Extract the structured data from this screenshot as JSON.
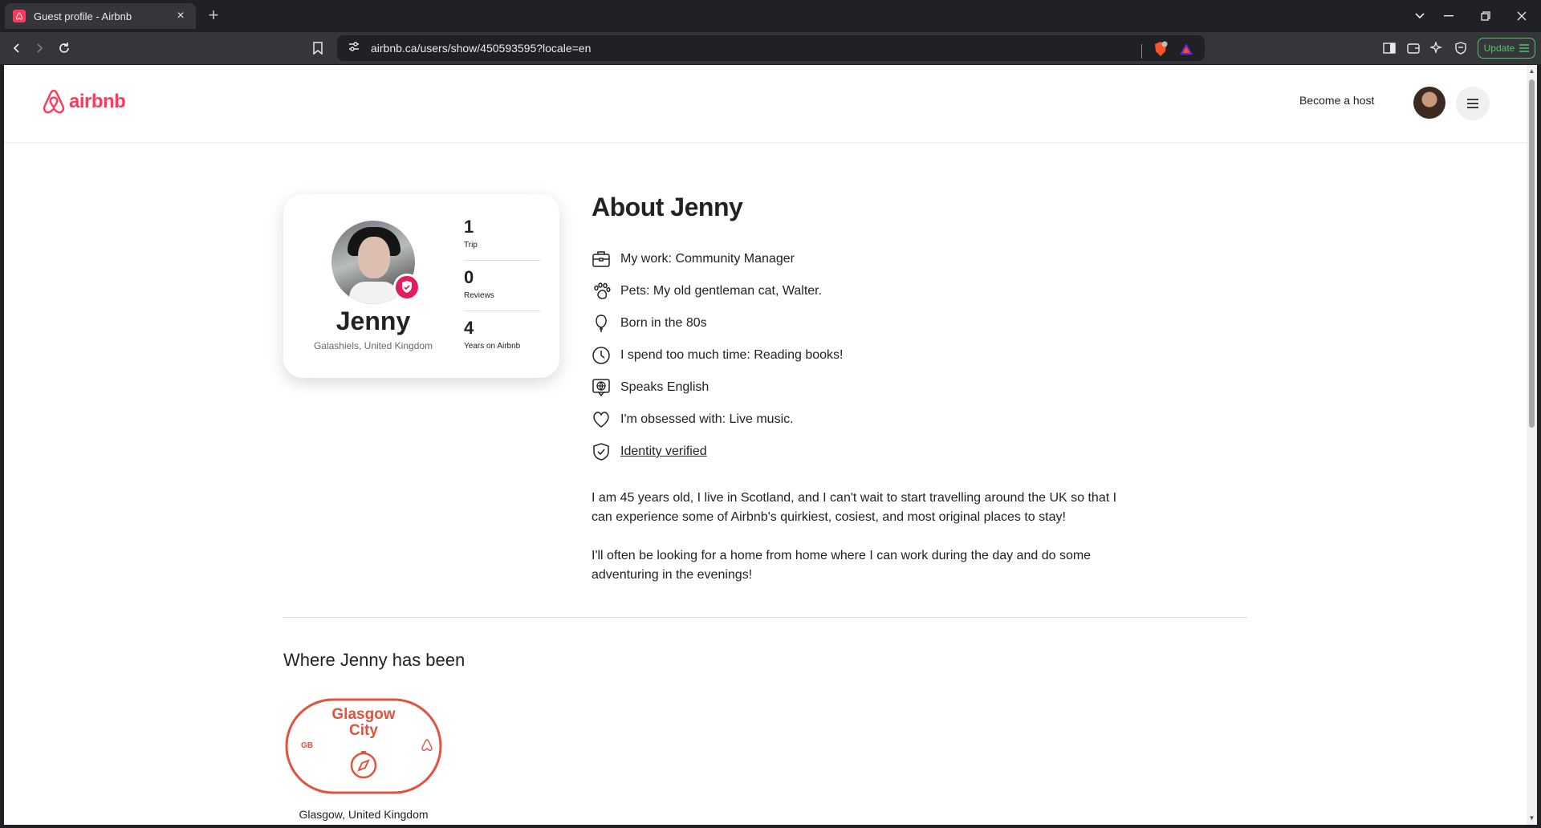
{
  "browser": {
    "tab_title": "Guest profile - Airbnb",
    "url": "airbnb.ca/users/show/450593595?locale=en",
    "update_label": "Update"
  },
  "header": {
    "brand": "airbnb",
    "become_host": "Become a host"
  },
  "profile": {
    "name": "Jenny",
    "location": "Galashiels, United Kingdom",
    "stats": [
      {
        "value": "1",
        "label": "Trip"
      },
      {
        "value": "0",
        "label": "Reviews"
      },
      {
        "value": "4",
        "label": "Years on Airbnb"
      }
    ]
  },
  "about": {
    "title": "About Jenny",
    "facts": [
      {
        "icon": "briefcase-icon",
        "text": "My work: Community Manager"
      },
      {
        "icon": "paw-icon",
        "text": "Pets: My old gentleman cat, Walter."
      },
      {
        "icon": "balloon-icon",
        "text": "Born in the 80s"
      },
      {
        "icon": "clock-icon",
        "text": "I spend too much time: Reading books!"
      },
      {
        "icon": "language-icon",
        "text": "Speaks English"
      },
      {
        "icon": "heart-icon",
        "text": "I'm obsessed with: Live music."
      },
      {
        "icon": "shield-check-icon",
        "text": "Identity verified"
      }
    ],
    "bio": [
      "I am 45 years old, I live in Scotland, and I can't wait to start travelling around the UK so that I can experience some of Airbnb's quirkiest, cosiest, and most original places to stay!",
      "I'll often be looking for a home from home where I can work during the day and do some adventuring in the evenings!"
    ]
  },
  "places": {
    "title": "Where Jenny has been",
    "items": [
      {
        "stamp_line1": "Glasgow",
        "stamp_line2": "City",
        "country_code": "GB",
        "caption": "Glasgow, United Kingdom"
      }
    ]
  },
  "colors": {
    "brand": "#ff385c",
    "badge": "#e31c5f",
    "stamp": "#e0533c",
    "update": "#59c26c"
  }
}
